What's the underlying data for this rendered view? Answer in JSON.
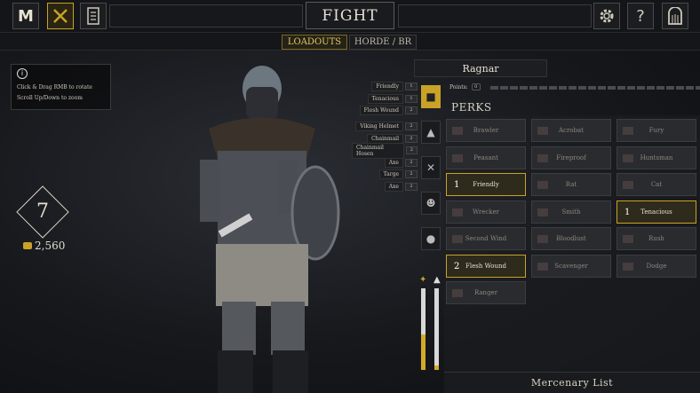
{
  "header": {
    "title": "FIGHT",
    "logo": "M"
  },
  "tabs": [
    {
      "label": "LOADOUTS",
      "active": true
    },
    {
      "label": "HORDE / BR",
      "active": false
    }
  ],
  "info": {
    "line1": "Click & Drag RMB to rotate",
    "line2": "Scroll Up/Down to zoom"
  },
  "player": {
    "level": "7",
    "gold": "2,560"
  },
  "loadout": {
    "name": "Ragnar",
    "points_label": "Points:",
    "points_value": "0",
    "items": [
      {
        "label": "Friendly",
        "pts": "1"
      },
      {
        "label": "Tenacious",
        "pts": "1"
      },
      {
        "label": "Flesh Wound",
        "pts": "2"
      },
      {
        "label": "Viking Helmet",
        "pts": "2"
      },
      {
        "label": "Chainmail",
        "pts": "2"
      },
      {
        "label": "Chainmail Hosen",
        "pts": "2"
      },
      {
        "label": "Axe",
        "pts": "2"
      },
      {
        "label": "Targe",
        "pts": "2"
      },
      {
        "label": "Axe",
        "pts": "2"
      }
    ]
  },
  "perks": {
    "title": "PERKS",
    "items": [
      {
        "label": "Brawler"
      },
      {
        "label": "Acrobat"
      },
      {
        "label": "Fury"
      },
      {
        "label": "Peasant"
      },
      {
        "label": "Fireproof"
      },
      {
        "label": "Huntsman"
      },
      {
        "label": "Friendly",
        "value": "1"
      },
      {
        "label": "Rat"
      },
      {
        "label": "Cat"
      },
      {
        "label": "Wrecker"
      },
      {
        "label": "Smith"
      },
      {
        "label": "Tenacious",
        "value": "1"
      },
      {
        "label": "Second Wind"
      },
      {
        "label": "Bloodlust"
      },
      {
        "label": "Rush"
      },
      {
        "label": "Flesh Wound",
        "value": "2"
      },
      {
        "label": "Scavenger"
      },
      {
        "label": "Dodge"
      },
      {
        "label": "Ranger"
      }
    ]
  },
  "stats": {
    "bar1_fill": 0.43,
    "bar2_fill": 0.05
  },
  "footer": {
    "mercenary_label": "Mercenary List"
  },
  "colors": {
    "accent": "#c9a227"
  }
}
